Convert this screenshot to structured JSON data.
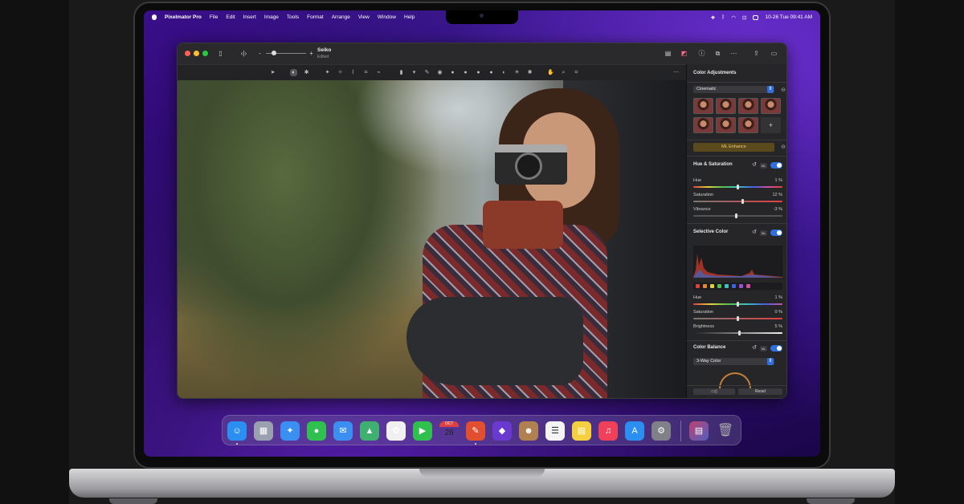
{
  "menubar": {
    "app": "Pixelmator Pro",
    "items": [
      "File",
      "Edit",
      "Insert",
      "Image",
      "Tools",
      "Format",
      "Arrange",
      "View",
      "Window",
      "Help"
    ],
    "datetime": "10-26 Tue  09:41 AM"
  },
  "window": {
    "doc_title": "Seiko",
    "doc_status": "Edited"
  },
  "panel": {
    "title": "Color Adjustments",
    "preset_select": "Cinematic",
    "ml_enhance": "ML Enhance",
    "ml_badge": "ML",
    "hue_saturation": {
      "title": "Hue & Saturation",
      "hue_label": "Hue",
      "hue_value": "1 %",
      "hue_level": 0.5,
      "saturation_label": "Saturation",
      "saturation_value": "12 %",
      "saturation_level": 0.56,
      "vibrance_label": "Vibrance",
      "vibrance_value": "-3 %",
      "vibrance_level": 0.48
    },
    "selective_color": {
      "title": "Selective Color",
      "hue_label": "Hue",
      "hue_value": "1 %",
      "hue_level": 0.5,
      "saturation_label": "Saturation",
      "saturation_value": "0 %",
      "saturation_level": 0.5,
      "brightness_label": "Brightness",
      "brightness_value": "5 %",
      "brightness_level": 0.52,
      "swatch_colors": [
        "#e04040",
        "#e08a30",
        "#e0d040",
        "#50c050",
        "#40c0c0",
        "#4060e0",
        "#9a50d0",
        "#d050a0"
      ]
    },
    "color_balance": {
      "title": "Color Balance",
      "mode_select": "3-Way Color"
    },
    "reset_label": "Reset",
    "accent_color": "#2f6fde"
  },
  "dock": {
    "apps": [
      {
        "name": "finder-icon",
        "glyph": "☺",
        "color": "#2a8ff0"
      },
      {
        "name": "launchpad-icon",
        "glyph": "▦",
        "color": "#9aa0b0"
      },
      {
        "name": "safari-icon",
        "glyph": "✦",
        "color": "#3a8ff0"
      },
      {
        "name": "messages-icon",
        "glyph": "●",
        "color": "#30c050"
      },
      {
        "name": "mail-icon",
        "glyph": "✉",
        "color": "#3a8ff0"
      },
      {
        "name": "maps-icon",
        "glyph": "▲",
        "color": "#40b070"
      },
      {
        "name": "photos-icon",
        "glyph": "✿",
        "color": "#f0f0f0"
      },
      {
        "name": "facetime-icon",
        "glyph": "▶",
        "color": "#30c050"
      },
      {
        "name": "calendar-icon",
        "glyph": "26",
        "color": "#f4f4f4"
      },
      {
        "name": "pixelmator-icon",
        "glyph": "✎",
        "color": "#e05030"
      },
      {
        "name": "shortcuts-icon",
        "glyph": "◆",
        "color": "#6a3ad0"
      },
      {
        "name": "contacts-icon",
        "glyph": "☻",
        "color": "#b08050"
      },
      {
        "name": "reminders-icon",
        "glyph": "☰",
        "color": "#f4f4f4"
      },
      {
        "name": "notes-icon",
        "glyph": "▤",
        "color": "#f4d040"
      },
      {
        "name": "music-icon",
        "glyph": "♫",
        "color": "#f0405a"
      },
      {
        "name": "app-store-icon",
        "glyph": "A",
        "color": "#2a8ff0"
      },
      {
        "name": "system-preferences-icon",
        "glyph": "⚙",
        "color": "#808088"
      }
    ],
    "calendar_month": "OCT",
    "calendar_day": "26"
  }
}
